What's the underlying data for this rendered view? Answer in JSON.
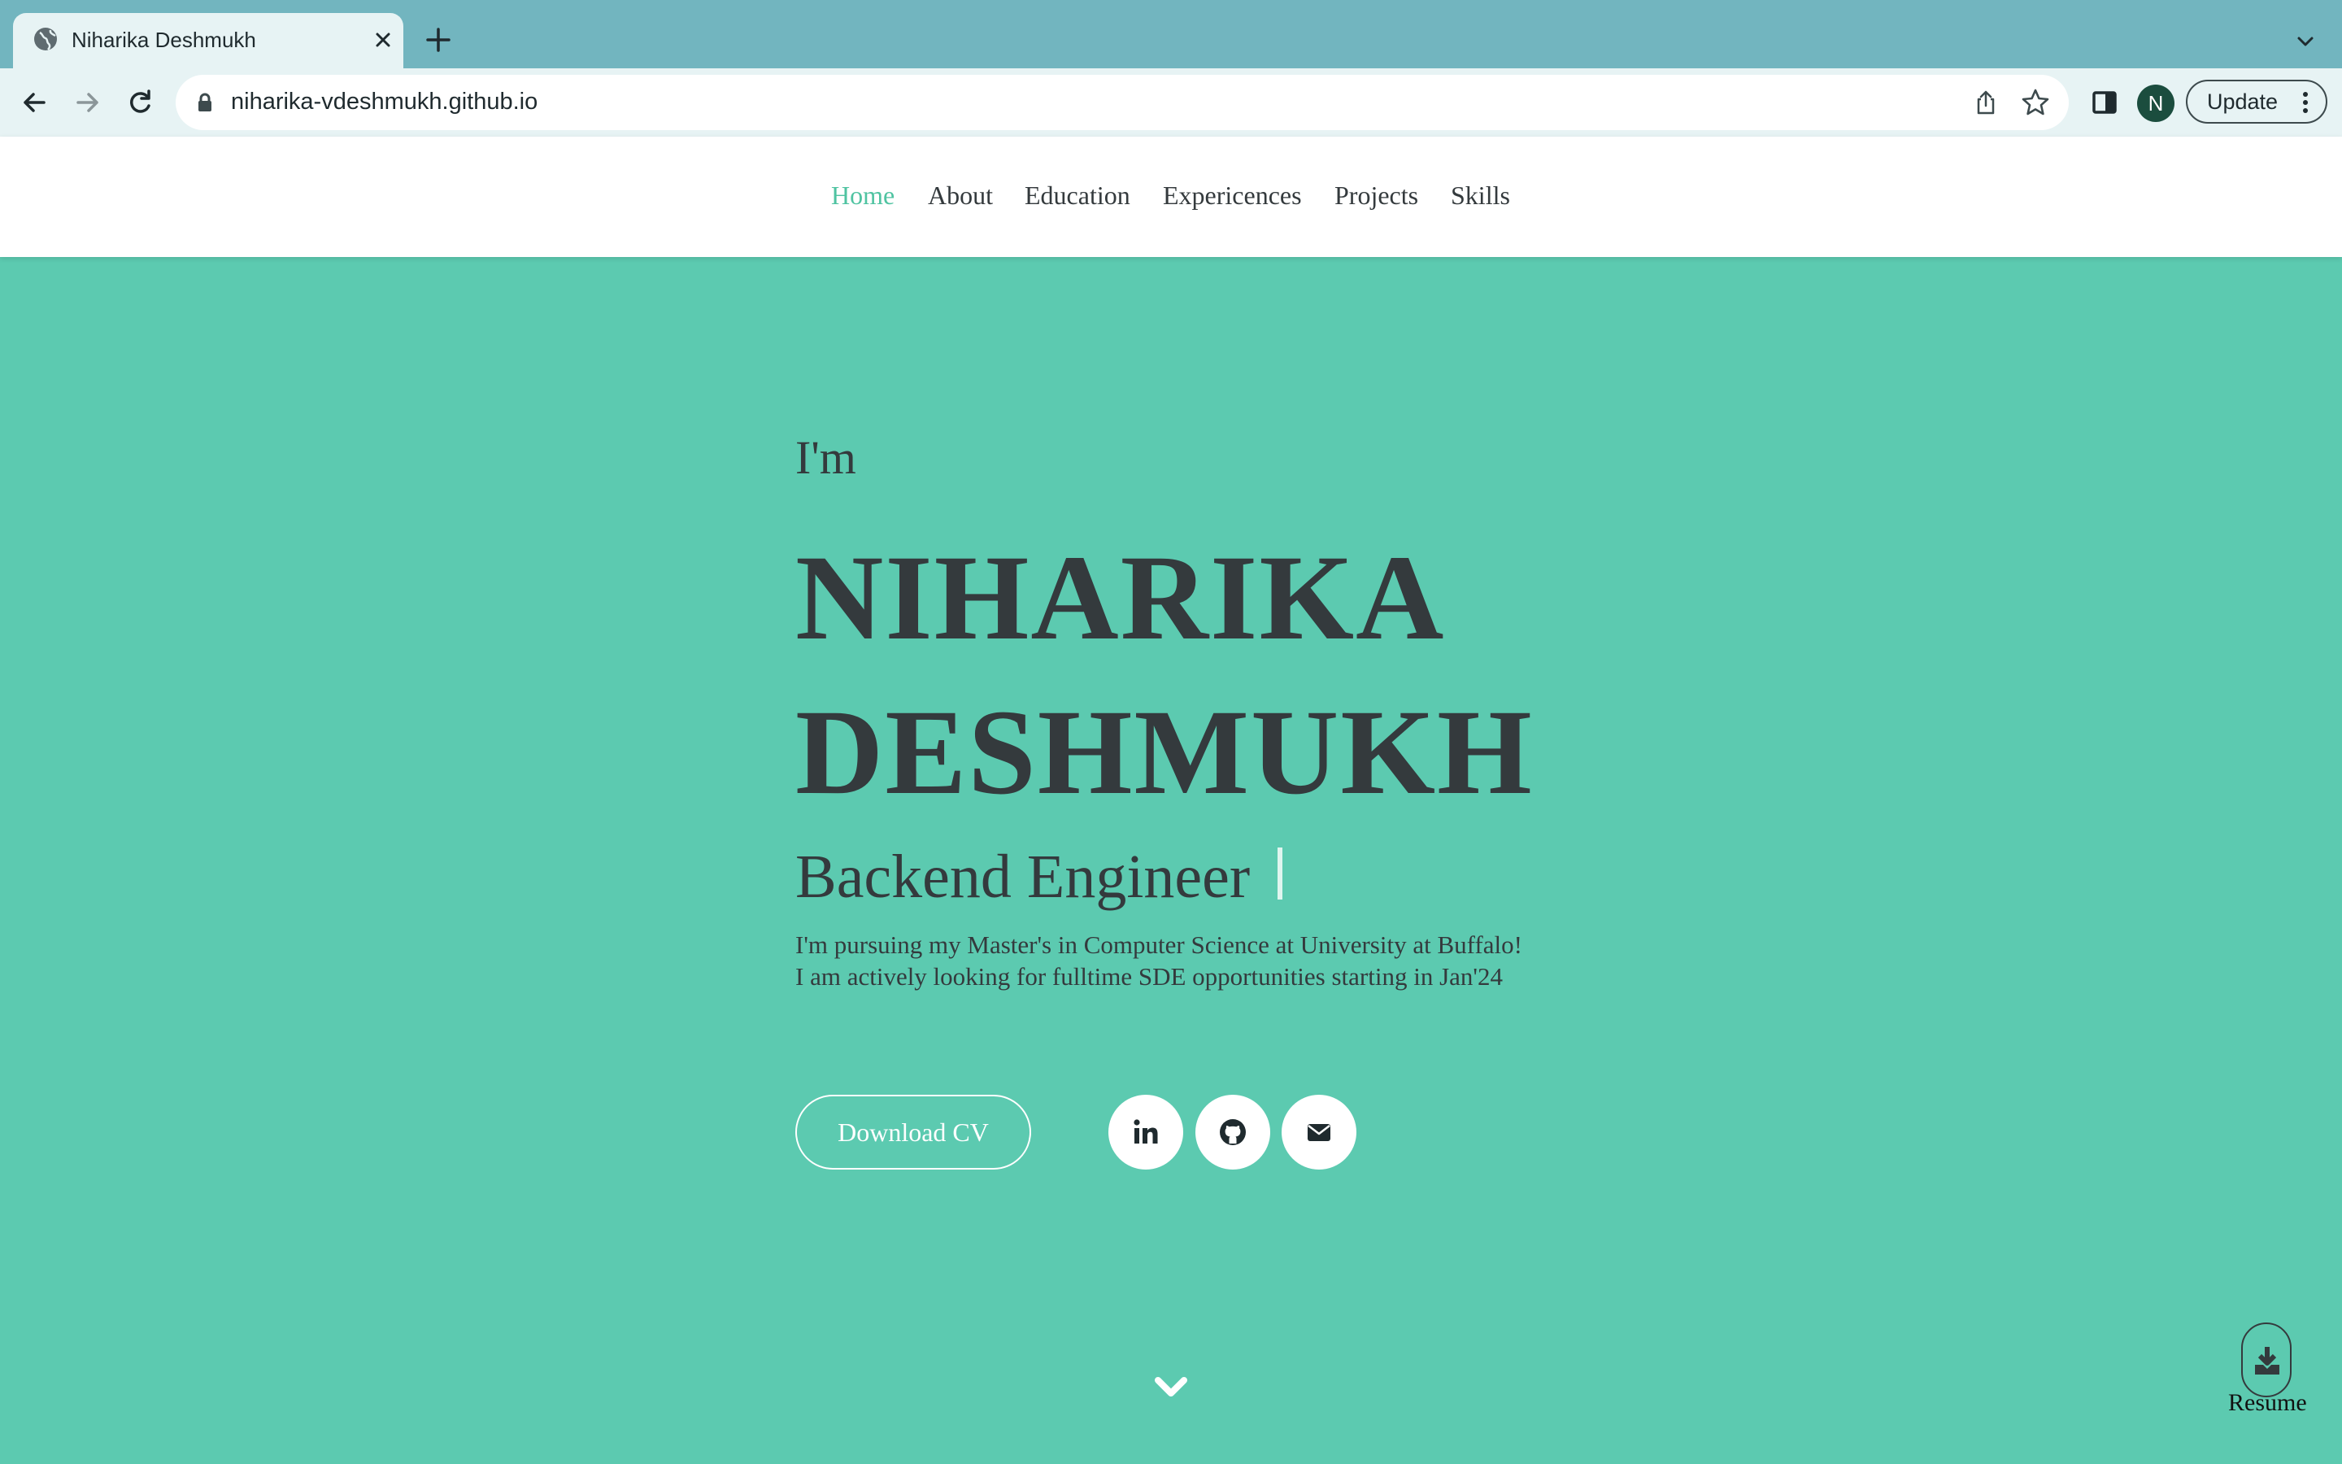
{
  "browser": {
    "tab_title": "Niharika Deshmukh",
    "url": "niharika-vdeshmukh.github.io",
    "profile_initial": "N",
    "update_label": "Update",
    "icons": [
      "globe-icon",
      "close-icon",
      "plus-icon",
      "chevron-down-icon",
      "back-arrow-icon",
      "forward-arrow-icon",
      "reload-icon",
      "lock-icon",
      "share-icon",
      "star-icon",
      "side-panel-icon",
      "kebab-menu-icon"
    ]
  },
  "nav": {
    "items": [
      {
        "label": "Home",
        "active": true
      },
      {
        "label": "About",
        "active": false
      },
      {
        "label": "Education",
        "active": false
      },
      {
        "label": "Expericences",
        "active": false
      },
      {
        "label": "Projects",
        "active": false
      },
      {
        "label": "Skills",
        "active": false
      }
    ]
  },
  "hero": {
    "intro": "I'm",
    "name_line1": "NIHARIKA",
    "name_line2": "DESHMUKH",
    "role": "Backend Engineer",
    "desc_line1": "I'm pursuing my Master's in Computer Science at University at Buffalo!",
    "desc_line2": "I am actively looking for fulltime SDE opportunities starting in Jan'24",
    "cv_button": "Download CV",
    "social_icons": [
      "linkedin-icon",
      "github-icon",
      "envelope-icon"
    ]
  },
  "resume_widget": {
    "label": "Resume",
    "icon": "download-icon"
  },
  "colors": {
    "accent": "#5ccab0",
    "nav_active": "#4fc3a1",
    "text_dark": "#343a3d",
    "browser_frame": "#72b5bf"
  }
}
